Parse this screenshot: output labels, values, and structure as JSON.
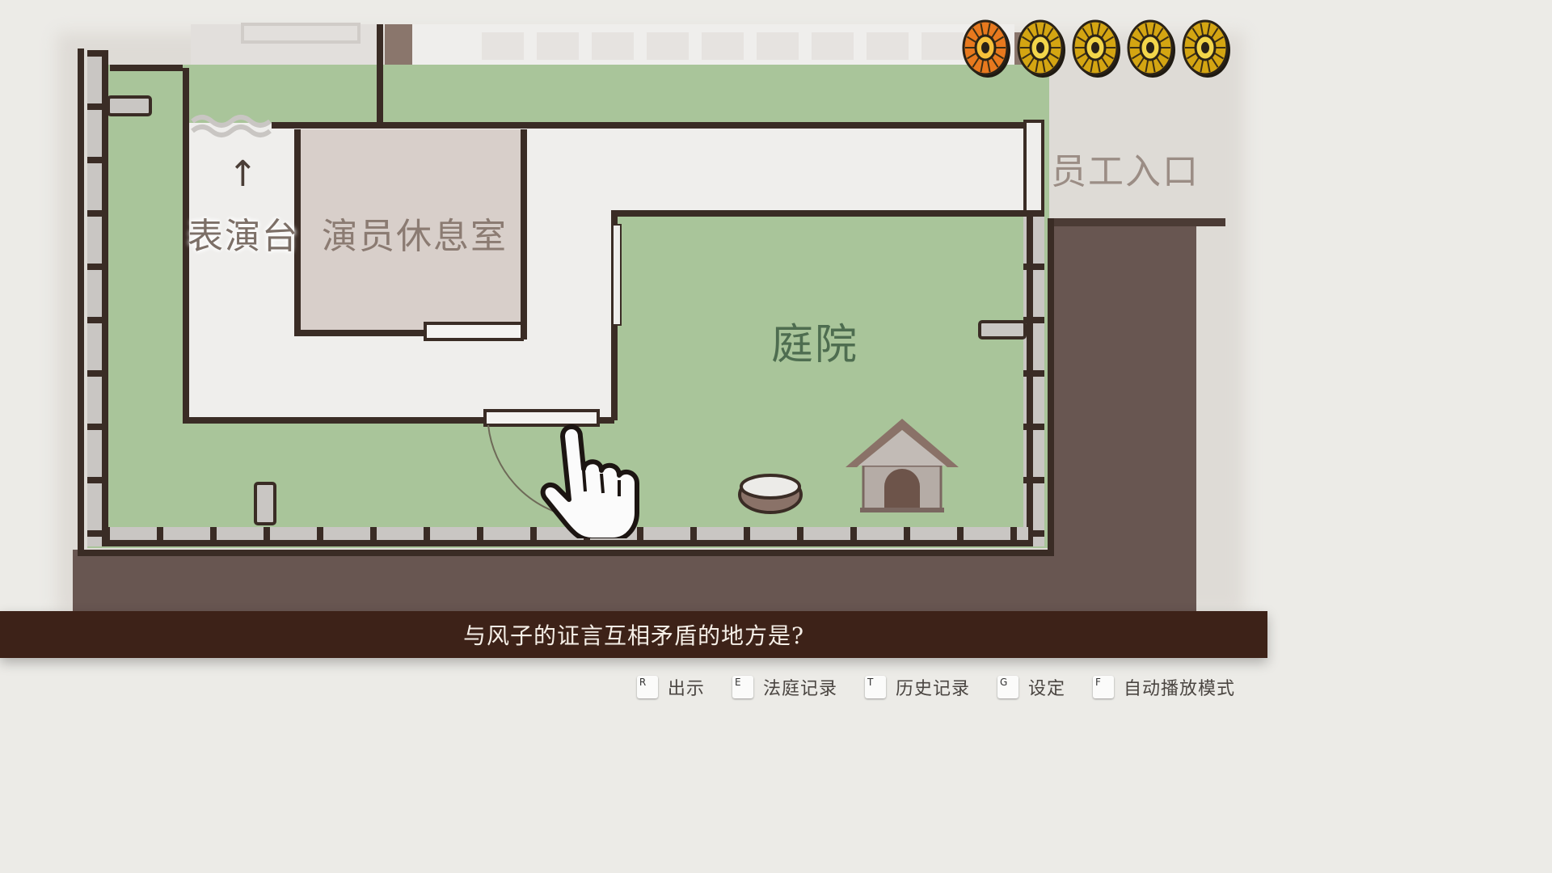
{
  "map": {
    "rooms": {
      "stage": "表演台",
      "dressing_room": "演员休息室",
      "courtyard": "庭院",
      "staff_entrance": "员工入口"
    },
    "arrow_glyph": "↑"
  },
  "badges": {
    "count": 5,
    "highlighted_index": 0,
    "colors": {
      "highlighted": "#e8791e",
      "normal": "#d4a512"
    }
  },
  "question": "与风子的证言互相矛盾的地方是?",
  "controls": [
    {
      "key": "R",
      "label": "出示"
    },
    {
      "key": "E",
      "label": "法庭记录"
    },
    {
      "key": "T",
      "label": "历史记录"
    },
    {
      "key": "G",
      "label": "设定"
    },
    {
      "key": "F",
      "label": "自动播放模式"
    }
  ],
  "colors": {
    "wall": "#3a2c25",
    "grass": "#a9c59a",
    "floor": "#efeeec",
    "dressing": "#d8cfca",
    "dark_ground": "#685651",
    "bar": "#3d2218"
  }
}
